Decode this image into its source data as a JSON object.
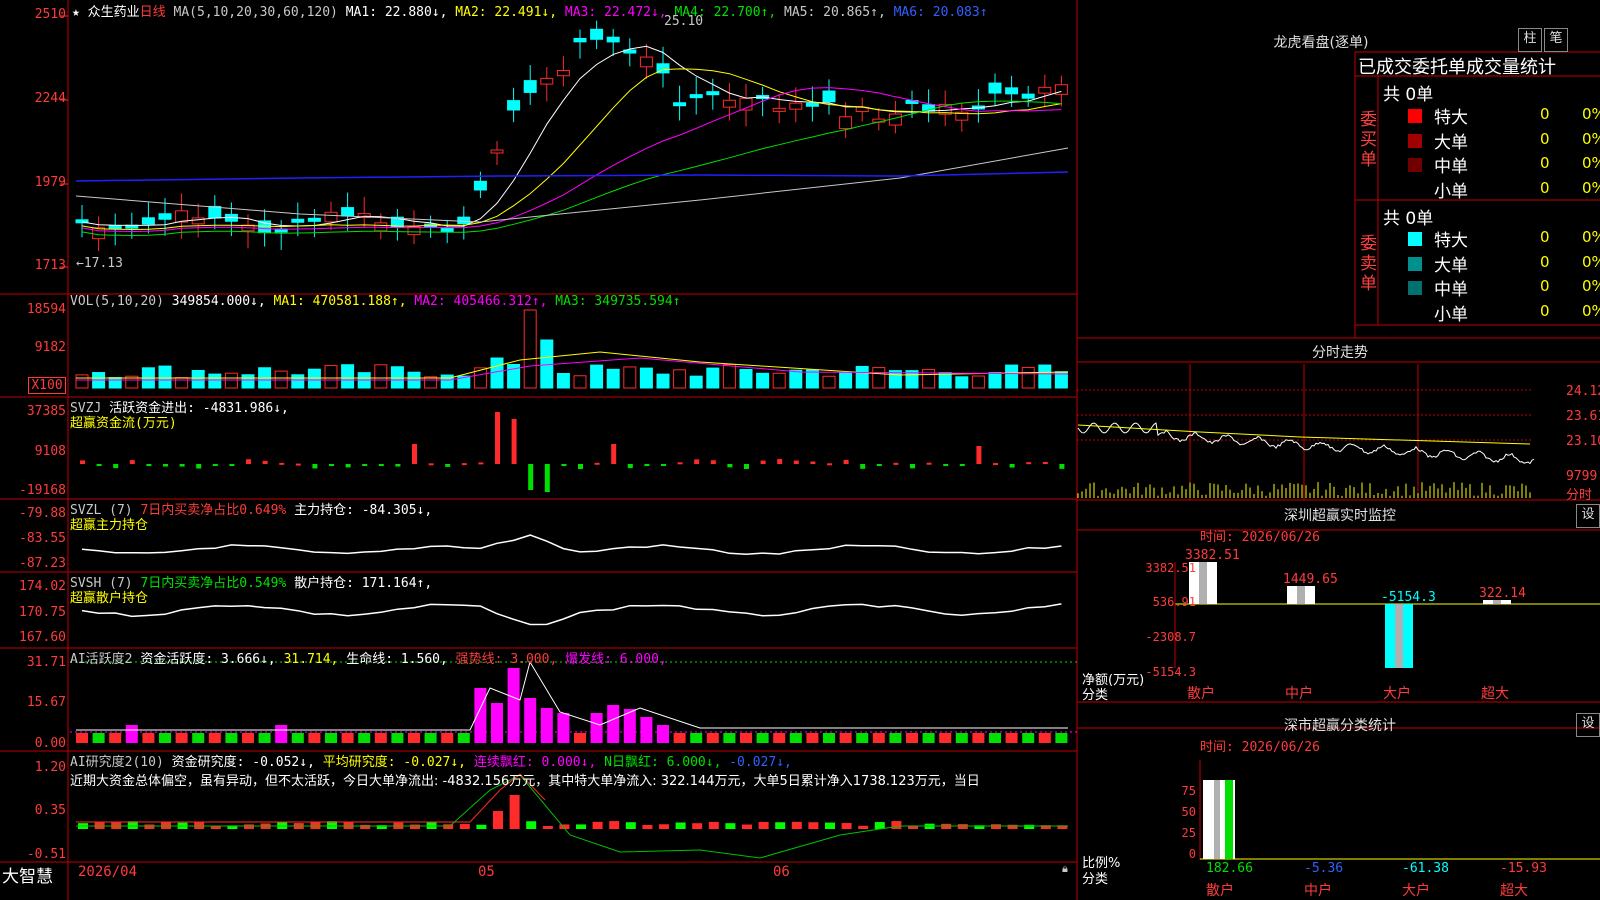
{
  "colors": {
    "up": "#ff2a2a",
    "down": "#00ffff",
    "bg": "#000000",
    "grid": "#c00000"
  },
  "header": {
    "star": "★",
    "stock_name": "众生药业",
    "period": "日线",
    "ma_params": "MA(5,10,20,30,60,120)",
    "ma1": "MA1: 22.880↓,",
    "ma2": "MA2: 22.491↓,",
    "ma3": "MA3: 22.472↓,",
    "ma4": "MA4: 22.700↑,",
    "ma5": "MA5: 20.865↑,",
    "ma6": "MA6: 20.083↑",
    "high_mark": "25.10",
    "low_mark": "←17.13"
  },
  "price_axis": [
    "2510",
    "2244",
    "1979",
    "1713"
  ],
  "vol": {
    "axis": [
      "18594",
      "9182",
      "X100"
    ],
    "title": "VOL(5,10,20)",
    "value": "349854.000↓,",
    "ma1": "MA1: 470581.188↑,",
    "ma2": "MA2: 405466.312↑,",
    "ma3": "MA3: 349735.594↑"
  },
  "svzj": {
    "axis": [
      "37385",
      "9108",
      "-19168"
    ],
    "title": "SVZJ",
    "text": "活跃资金进出: -4831.986↓,",
    "sub": "超赢资金流(万元)"
  },
  "svzl": {
    "axis": [
      "-79.88",
      "-83.55",
      "-87.23"
    ],
    "title": "SVZL (7)",
    "ratio": "7日内买卖净占比0.649%",
    "text": "主力持仓: -84.305↓,",
    "sub": "超赢主力持仓"
  },
  "svsh": {
    "axis": [
      "174.02",
      "170.75",
      "167.60"
    ],
    "title": "SVSH (7)",
    "ratio": "7日内买卖净占比0.549%",
    "text": "散户持仓: 171.164↑,",
    "sub": "超赢散户持仓"
  },
  "ai_active": {
    "axis": [
      "31.71",
      "15.67",
      "0.00"
    ],
    "title": "AI活跃度2",
    "t1": "资金活跃度: 3.666↓,",
    "t2": "31.714,",
    "t3": "生命线: 1.560,",
    "t4": "强势线: 3.000,",
    "t5": "爆发线: 6.000,"
  },
  "ai_research": {
    "axis": [
      "1.20",
      "0.35",
      "-0.51"
    ],
    "title": "AI研究度2(10)",
    "t1": "资金研究度: -0.052↓,",
    "t2": "平均研究度: -0.027↓,",
    "t3": "连续飘红: 0.000↓,",
    "t4": "N日飘红: 6.000↓,",
    "t5": "-0.027↓,",
    "comment": "近期大资金总体偏空，虽有异动，但不太活跃，今日大单净流出: -4832.156万元，其中特大单净流入: 322.144万元，大单5日累计净入1738.123万元，当日"
  },
  "bottom": {
    "brand": "大智慧",
    "date_start": "2026/04",
    "m05": "05",
    "m06": "06"
  },
  "longhu": {
    "title": "龙虎看盘(逐单)",
    "btn_zhu": "柱",
    "btn_bi": "笔",
    "subtitle": "已成交委托单成交量统计",
    "buy_label": "委买单",
    "sell_label": "委卖单",
    "buy_total": "共 0单",
    "sell_total": "共 0单",
    "buy_rows": [
      {
        "name": "特大",
        "count": "0",
        "pct": "0%",
        "color": "#ff0000"
      },
      {
        "name": "大单",
        "count": "0",
        "pct": "0%",
        "color": "#a00000"
      },
      {
        "name": "中单",
        "count": "0",
        "pct": "0%",
        "color": "#700000"
      },
      {
        "name": "小单",
        "count": "0",
        "pct": "0%",
        "color": "#000000"
      }
    ],
    "sell_rows": [
      {
        "name": "特大",
        "count": "0",
        "pct": "0%",
        "color": "#00ffff"
      },
      {
        "name": "大单",
        "count": "0",
        "pct": "0%",
        "color": "#009090"
      },
      {
        "name": "中单",
        "count": "0",
        "pct": "0%",
        "color": "#007070"
      },
      {
        "name": "小单",
        "count": "0",
        "pct": "0%",
        "color": "#000000"
      }
    ]
  },
  "intraday": {
    "title": "分时走势",
    "axis": [
      "24.12",
      "23.61",
      "23.10",
      "9799"
    ],
    "tag": "分时"
  },
  "sz_monitor": {
    "title": "深圳超赢实时监控",
    "btn": "设",
    "time": "时间: 2026/06/26",
    "axis": [
      "3382.51",
      "536.91",
      "-2308.7",
      "-5154.3"
    ],
    "ylabel": "净额(万元)",
    "xlabel": "分类",
    "cats": [
      "散户",
      "中户",
      "大户",
      "超大"
    ],
    "values": [
      3382.51,
      1449.65,
      -5154.3,
      322.14
    ],
    "value_labels": [
      "3382.51",
      "1449.65",
      "-5154.3",
      "322.14"
    ]
  },
  "sz_stats": {
    "title": "深市超赢分类统计",
    "btn": "设",
    "time": "时间: 2026/06/26",
    "axis": [
      "75",
      "50",
      "25",
      "0"
    ],
    "ylabel": "比例%",
    "xlabel": "分类",
    "cats": [
      "散户",
      "中户",
      "大户",
      "超大"
    ],
    "values": [
      "182.66",
      "-5.36",
      "-61.38",
      "-15.93"
    ]
  }
}
